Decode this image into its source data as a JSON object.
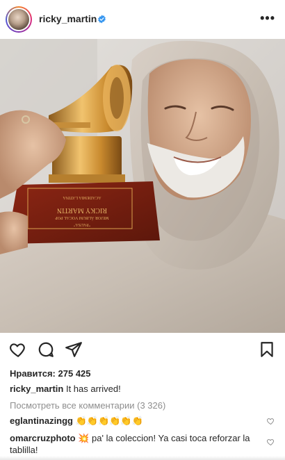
{
  "header": {
    "username": "ricky_martin",
    "more_icon": "more-horizontal-icon",
    "verified_icon": "verified-badge-icon"
  },
  "trophy": {
    "line1": "ACADEMIA LATINA DE ARTES Y CIENCIAS DE LA GRABACIÓN",
    "line2": "RICKY MARTIN",
    "line3": "MEJOR ÁLBUM VOCAL POP – 2020",
    "line4": "\"PAUSA\""
  },
  "actions": {
    "like_icon": "heart-icon",
    "comment_icon": "comment-icon",
    "share_icon": "send-icon",
    "save_icon": "bookmark-icon"
  },
  "likes": {
    "label": "Нравится:",
    "count": "275 425"
  },
  "caption": {
    "user": "ricky_martin",
    "text": "It has arrived!"
  },
  "view_all_comments": "Посмотреть все комментарии (3 326)",
  "comments": [
    {
      "user": "eglantinazingg",
      "text": "👏👏👏👏👏👏"
    },
    {
      "user": "omarcruzphoto",
      "text": "💥 pa' la coleccion! Ya casi toca reforzar la tablilla!"
    }
  ]
}
